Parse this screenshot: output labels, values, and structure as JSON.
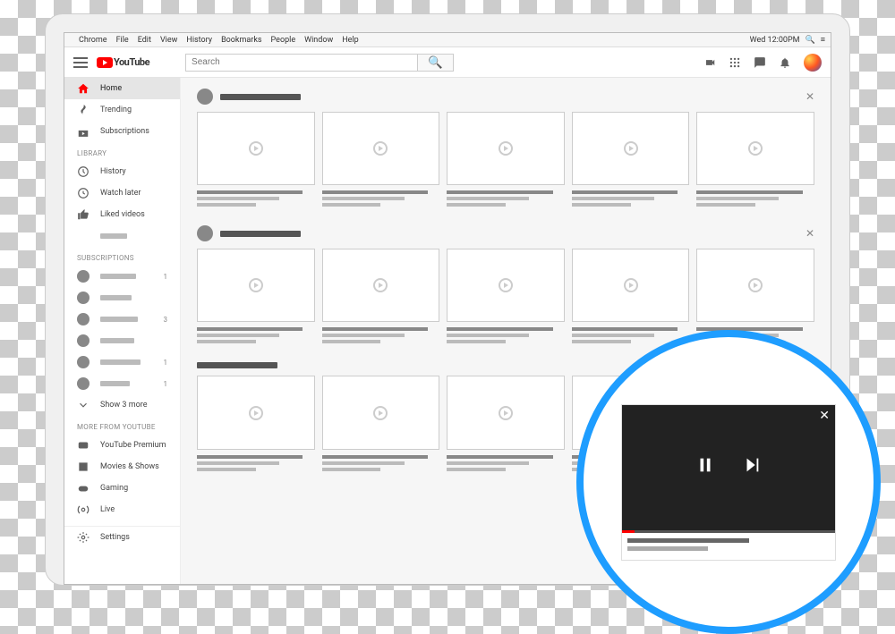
{
  "menubar": {
    "items": [
      "Chrome",
      "File",
      "Edit",
      "View",
      "History",
      "Bookmarks",
      "People",
      "Window",
      "Help"
    ],
    "clock": "Wed 12:00PM"
  },
  "header": {
    "logo_text": "YouTube",
    "search_placeholder": "Search"
  },
  "sidebar": {
    "primary": [
      {
        "icon": "home",
        "label": "Home",
        "active": true
      },
      {
        "icon": "fire",
        "label": "Trending"
      },
      {
        "icon": "subs",
        "label": "Subscriptions"
      }
    ],
    "library_title": "LIBRARY",
    "library": [
      {
        "icon": "history",
        "label": "History"
      },
      {
        "icon": "clock",
        "label": "Watch later"
      },
      {
        "icon": "thumb",
        "label": "Liked videos"
      },
      {
        "icon": "list",
        "label": ""
      }
    ],
    "subs_title": "SUBSCRIPTIONS",
    "subs": [
      {
        "count": "1"
      },
      {
        "count": ""
      },
      {
        "count": "3"
      },
      {
        "count": ""
      },
      {
        "count": "1"
      },
      {
        "count": "1"
      }
    ],
    "show_more": "Show 3 more",
    "more_title": "MORE FROM YOUTUBE",
    "more": [
      {
        "icon": "premium",
        "label": "YouTube Premium"
      },
      {
        "icon": "movies",
        "label": "Movies & Shows"
      },
      {
        "icon": "gaming",
        "label": "Gaming"
      },
      {
        "icon": "live",
        "label": "Live"
      }
    ],
    "settings_label": "Settings"
  },
  "main": {
    "shelves": [
      {
        "has_avatar": true,
        "closable": true,
        "cards": 5
      },
      {
        "has_avatar": true,
        "closable": true,
        "cards": 5
      },
      {
        "has_avatar": false,
        "closable": false,
        "cards": 5
      }
    ]
  },
  "miniplayer": {
    "close": "✕",
    "pause": "❚❚",
    "next": "▶|"
  }
}
